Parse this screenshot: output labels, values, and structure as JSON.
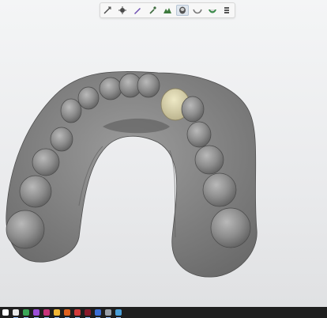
{
  "toolbar": {
    "tools": [
      {
        "name": "measure-tool-icon",
        "color": "#4a4a4a"
      },
      {
        "name": "sculpt-tool-icon",
        "color": "#4a4a4a"
      },
      {
        "name": "pen-tool-icon",
        "color": "#6b4bb0"
      },
      {
        "name": "wand-tool-icon",
        "color": "#3d6a3d"
      },
      {
        "name": "region-tool-icon",
        "color": "#3d7a3d"
      },
      {
        "name": "view-tooth-icon",
        "color": "#555555",
        "active": true
      },
      {
        "name": "jaw-view-icon",
        "color": "#777777"
      },
      {
        "name": "gum-view-icon",
        "color": "#3a8a4a"
      },
      {
        "name": "layers-tool-icon",
        "color": "#555555"
      }
    ]
  },
  "model": {
    "name": "dental-arch-scan",
    "base_color": "#8a8a8a",
    "highlight_color": "#d9d3a8"
  },
  "taskbar": {
    "apps": [
      {
        "name": "start-icon",
        "color": "#ffffff"
      },
      {
        "name": "edge-icon",
        "color": "#e9e9e9"
      },
      {
        "name": "chrome-icon",
        "color": "#3aa757"
      },
      {
        "name": "app-purple-icon",
        "color": "#9c4dd8"
      },
      {
        "name": "app-magenta-icon",
        "color": "#c8327a"
      },
      {
        "name": "file-explorer-icon",
        "color": "#f2b836"
      },
      {
        "name": "app-orange-icon",
        "color": "#e1621f"
      },
      {
        "name": "app-red-icon",
        "color": "#d23b3b"
      },
      {
        "name": "app-darkred-icon",
        "color": "#8a1b2c"
      },
      {
        "name": "app-blue-icon",
        "color": "#3b6fd6"
      },
      {
        "name": "app-grey-icon",
        "color": "#9aa0a8"
      },
      {
        "name": "dental-app-icon",
        "color": "#4a9fd8"
      }
    ]
  }
}
